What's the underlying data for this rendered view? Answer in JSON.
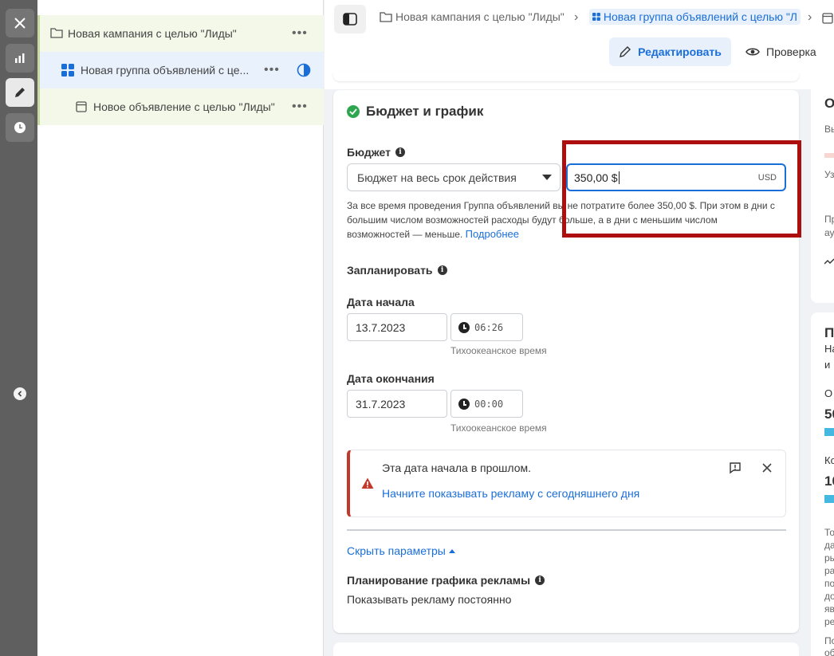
{
  "rail": {
    "items": [
      "close-icon",
      "chart-icon",
      "pencil-icon",
      "clock-icon"
    ]
  },
  "tree": {
    "campaign": "Новая кампания с целью \"Лиды\"",
    "adset": "Новая группа объявлений с це...",
    "ad": "Новое объявление с целью \"Лиды\"",
    "dots": "•••"
  },
  "breadcrumbs": {
    "campaign": "Новая кампания с целью \"Лиды\"",
    "adset": "Новая группа объявлений с целью \"Л",
    "sep": "›"
  },
  "toolbar": {
    "edit_label": "Редактировать",
    "review_label": "Проверка"
  },
  "budget_card": {
    "title": "Бюджет и график",
    "budget_label": "Бюджет",
    "budget_type": "Бюджет на весь срок действия",
    "budget_value": "350,00 $",
    "currency": "USD",
    "help_text": "За все время проведения Группа объявлений вы не потратите более 350,00 $. При этом в дни с большим числом возможностей расходы будут больше, а в дни с меньшим числом возможностей — меньше.",
    "help_link": "Подробнее",
    "schedule_label": "Запланировать",
    "start_label": "Дата начала",
    "start_date": "13.7.2023",
    "start_time": "06:26",
    "end_label": "Дата окончания",
    "end_date": "31.7.2023",
    "end_time": "00:00",
    "timezone": "Тихоокеанское время",
    "warning_title": "Эта дата начала в прошлом.",
    "warning_link": "Начните показывать рекламу с сегодняшнего дня",
    "hide_params": "Скрыть параметры",
    "ad_schedule_label": "Планирование графика рекламы",
    "ad_schedule_value": "Показывать рекламу постоянно"
  },
  "side_panel": {
    "t1": "О",
    "t2": "Вы",
    "t3": "Уз",
    "t4": "Пр",
    "t5": "ау",
    "t6": "П",
    "t7": "На",
    "t8": "и",
    "t9": "О",
    "t10": "50",
    "t11": "Ко",
    "t12": "10",
    "t13": "То",
    "t14": "да",
    "t15": "ры",
    "t16": "ра",
    "t17": "по",
    "t18": "до",
    "t19": "яв",
    "t20": "ре",
    "t21": "По",
    "t22": "об"
  },
  "colors": {
    "accent": "#1a6ed8",
    "highlight": "#ad0f0f",
    "warning": "#c0392b",
    "success": "#2ea64f"
  }
}
